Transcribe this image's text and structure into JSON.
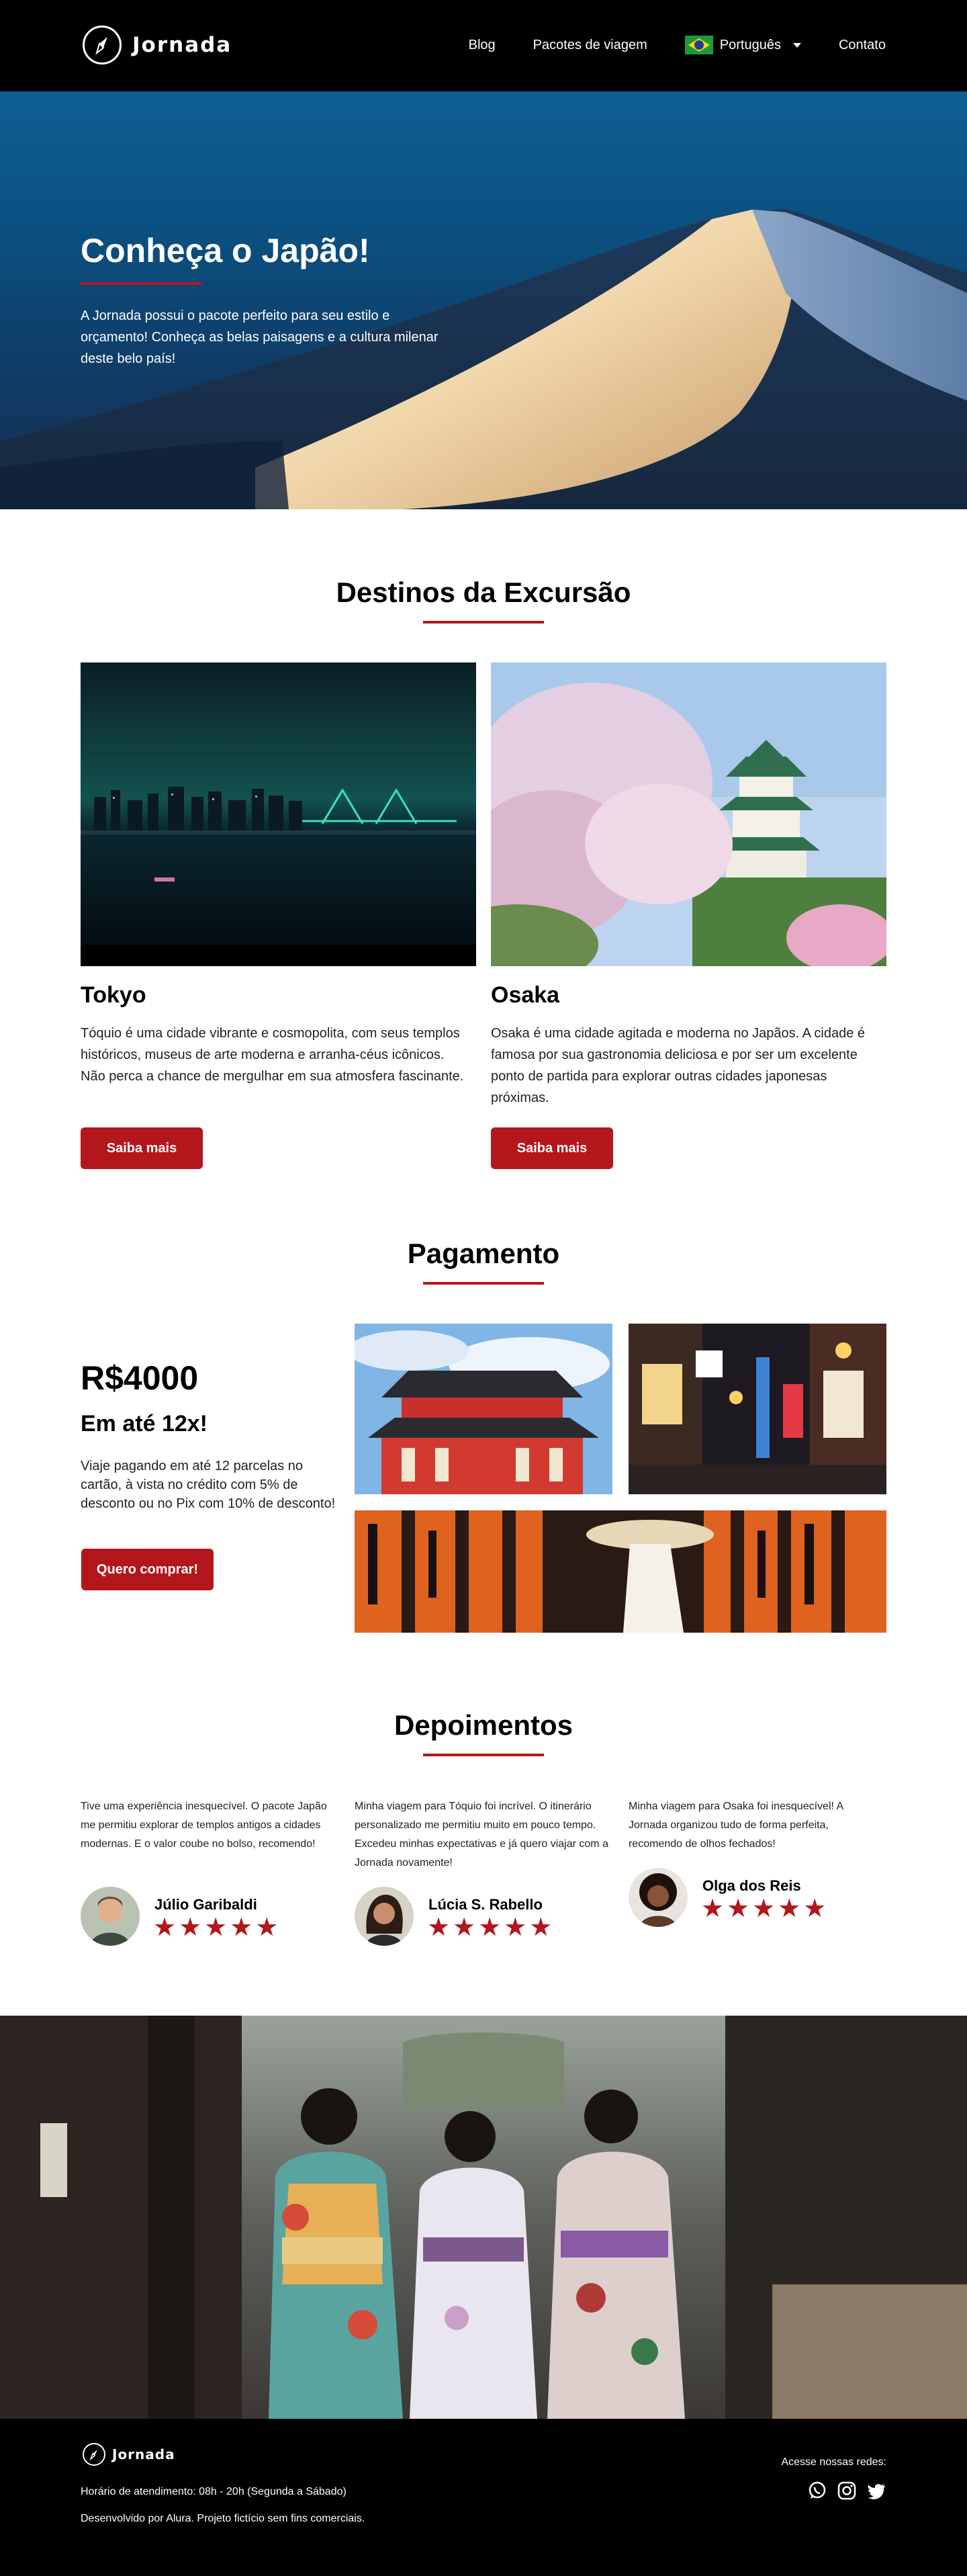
{
  "header": {
    "brand": "Jornada",
    "nav": {
      "blog": "Blog",
      "packages": "Pacotes de viagem",
      "language": "Português",
      "contact": "Contato"
    }
  },
  "hero": {
    "title": "Conheça o Japão!",
    "text": "A Jornada possui o pacote perfeito para seu estilo e orçamento! Conheça as belas paisagens e a  cultura milenar deste belo país!"
  },
  "destinations": {
    "title": "Destinos da Excursão",
    "items": [
      {
        "name": "Tokyo",
        "text": "Tóquio é uma cidade vibrante e cosmopolita, com seus templos históricos, museus de arte moderna e arranha-céus icônicos. Não perca a chance de mergulhar em sua atmosfera fascinante.",
        "button": "Saiba mais"
      },
      {
        "name": "Osaka",
        "text": "Osaka é uma cidade agitada e moderna no Japãos. A cidade é famosa por sua gastronomia deliciosa e por ser um excelente ponto de partida para explorar outras cidades japonesas próximas.",
        "button": "Saiba mais"
      }
    ]
  },
  "payment": {
    "title": "Pagamento",
    "price": "R$4000",
    "installments": "Em até 12x!",
    "text": "Viaje pagando em até 12 parcelas no cartão, à vista no crédito com 5% de desconto ou no Pix com 10% de desconto!",
    "button": "Quero comprar!"
  },
  "testimonials": {
    "title": "Depoimentos",
    "items": [
      {
        "text": "Tive uma experiência inesquecível. O pacote Japão me permitiu explorar  de templos antigos a cidades modernas. E o valor coube no bolso, recomendo!",
        "name": "Júlio Garibaldi",
        "rating": 5,
        "stars": "★★★★★"
      },
      {
        "text": "Minha viagem para Tóquio foi incrível. O itinerário personalizado me permitiu muito em pouco tempo. Excedeu minhas expectativas e já quero viajar com a Jornada novamente!",
        "name": "Lúcia S. Rabello",
        "rating": 5,
        "stars": "★★★★★"
      },
      {
        "text": "Minha viagem para Osaka foi inesquecível! A Jornada organizou tudo de forma perfeita, recomendo de olhos fechados!",
        "name": "Olga dos Reis",
        "rating": 5,
        "stars": "★★★★★"
      }
    ]
  },
  "footer": {
    "brand": "Jornada",
    "hours": "Horário de atendimento: 08h - 20h (Segunda a Sábado)",
    "credit": "Desenvolvido por Alura. Projeto fictício sem fins comerciais.",
    "social_label": "Acesse nossas redes:",
    "social_icons": [
      "whatsapp-icon",
      "instagram-icon",
      "twitter-icon"
    ]
  },
  "colors": {
    "accent": "#b3171c",
    "header_bg": "#000000"
  }
}
